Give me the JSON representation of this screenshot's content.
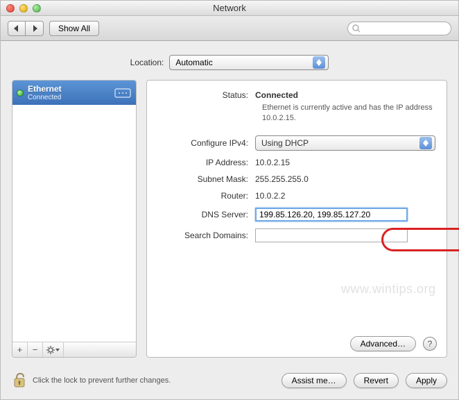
{
  "window": {
    "title": "Network"
  },
  "toolbar": {
    "show_all": "Show All",
    "search_placeholder": ""
  },
  "location": {
    "label": "Location:",
    "value": "Automatic"
  },
  "sidebar": {
    "service": {
      "name": "Ethernet",
      "status": "Connected"
    },
    "buttons": {
      "add": "+",
      "remove": "−",
      "gear": "✻▾"
    }
  },
  "detail": {
    "status_label": "Status:",
    "status_value": "Connected",
    "status_msg": "Ethernet is currently active and has the IP address 10.0.2.15.",
    "config_label": "Configure IPv4:",
    "config_value": "Using DHCP",
    "ip_label": "IP Address:",
    "ip_value": "10.0.2.15",
    "subnet_label": "Subnet Mask:",
    "subnet_value": "255.255.255.0",
    "router_label": "Router:",
    "router_value": "10.0.2.2",
    "dns_label": "DNS Server:",
    "dns_value": "199.85.126.20, 199.85.127.20",
    "search_label": "Search Domains:",
    "search_value": "",
    "advanced": "Advanced…"
  },
  "footer": {
    "lock_msg": "Click the lock to prevent further changes.",
    "assist": "Assist me…",
    "revert": "Revert",
    "apply": "Apply"
  },
  "watermark": "www.wintips.org"
}
